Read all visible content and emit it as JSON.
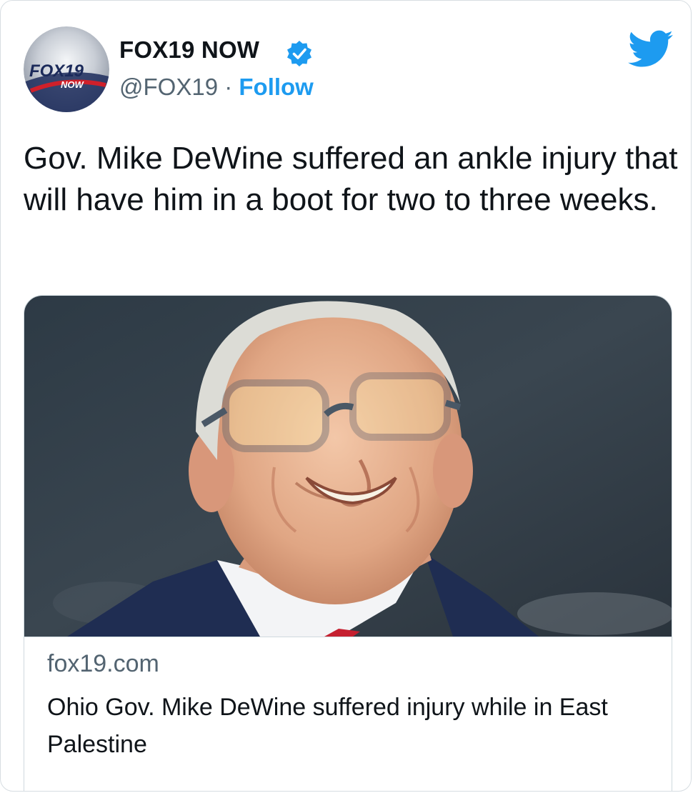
{
  "account": {
    "display_name": "FOX19 NOW",
    "handle": "@FOX19",
    "separator": " · ",
    "follow_label": "Follow",
    "avatar_logo_text": "FOX19",
    "avatar_logo_sub": "NOW"
  },
  "tweet": {
    "text": "Gov. Mike DeWine suffered an ankle injury that will have him in a boot for two to three weeks."
  },
  "link_card": {
    "domain": "fox19.com",
    "title": "Ohio Gov. Mike DeWine suffered injury while in East Palestine"
  },
  "icons": {
    "verified": "verified-badge-icon",
    "platform": "twitter-bird-icon"
  },
  "colors": {
    "accent": "#1d9bf0",
    "text": "#0f1419",
    "muted": "#536471",
    "border": "#cfd9de"
  }
}
